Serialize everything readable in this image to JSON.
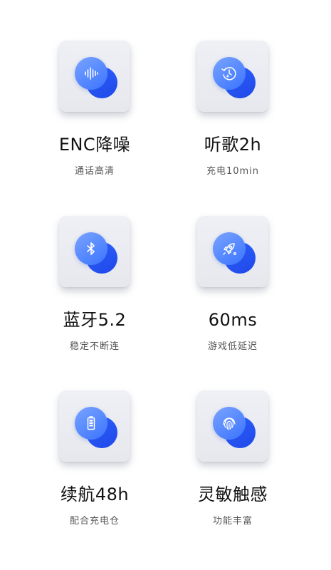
{
  "features": [
    {
      "title": "ENC降噪",
      "subtitle": "通话高清",
      "icon": "sound-wave-icon"
    },
    {
      "title": "听歌2h",
      "subtitle": "充电10min",
      "icon": "fast-charge-clock-icon"
    },
    {
      "title": "蓝牙5.2",
      "subtitle": "稳定不断连",
      "icon": "bluetooth-icon"
    },
    {
      "title": "60ms",
      "subtitle": "游戏低延迟",
      "icon": "rocket-icon"
    },
    {
      "title": "续航48h",
      "subtitle": "配合充电仓",
      "icon": "battery-icon"
    },
    {
      "title": "灵敏触感",
      "subtitle": "功能丰富",
      "icon": "fingerprint-icon"
    }
  ],
  "colors": {
    "accent": "#2f66ff",
    "card": "#eef0f5",
    "title": "#111111",
    "subtitle": "#555555"
  }
}
